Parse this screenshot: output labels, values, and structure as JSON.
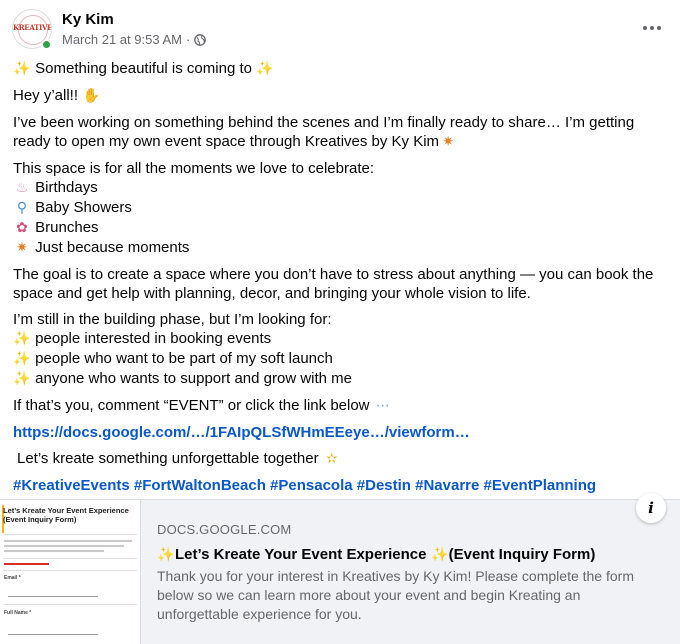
{
  "post": {
    "author": "Ky Kim",
    "avatar_logo_text": "KREATIVES",
    "timestamp": "March 21 at 9:53 AM",
    "privacy_separator": "·",
    "privacy_icon": "globe-icon",
    "more_icon": "more-options-icon",
    "online_status_color": "#31a24c"
  },
  "content": {
    "headline": "Something beautiful is coming to",
    "greeting": "Hey y’all!!",
    "intro_line1": "I’ve been working on something behind the scenes and I’m finally ready to share… I’m getting",
    "intro_line2": "ready to open my own event space through Kreatives by Ky Kim",
    "moments_heading": "This space is for all the moments we love to celebrate:",
    "moments": [
      {
        "icon": "birthday-cake-icon",
        "label": "Birthdays"
      },
      {
        "icon": "baby-bottle-icon",
        "label": "Baby Showers"
      },
      {
        "icon": "bouquet-icon",
        "label": "Brunches"
      },
      {
        "icon": "party-popper-icon",
        "label": "Just because moments"
      }
    ],
    "goal_line1": "The goal is to create a space where you don’t have to stress about anything — you can book the",
    "goal_line2": "space and get help with planning, decor, and bringing your whole vision to life.",
    "looking_heading": "I’m still in the building phase, but I’m looking for:",
    "looking_for": [
      "people interested in booking events",
      "people who want to be part of my soft launch",
      "anyone who wants to support and grow with me"
    ],
    "cta": "If that’s you, comment “EVENT” or click the link below",
    "link_text": "https://docs.google.com/…/1FAIpQLSfWHmEEeye…/viewform…",
    "closing": "Let’s kreate something unforgettable together",
    "hashtags": [
      "#KreativeEvents",
      "#FortWaltonBeach",
      "#Pensacola",
      "#Destin",
      "#Navarre",
      "#EventPlanning"
    ]
  },
  "link_card": {
    "domain": "DOCS.GOOGLE.COM",
    "title": "Let’s Kreate Your Event Experience",
    "title_suffix": "(Event Inquiry Form)",
    "description": "Thank you for your interest in Kreatives by Ky Kim! Please complete the form below so we can learn more about your event and begin Kreating an unforgettable experience for you.",
    "thumbnail_title": "Let’s Kreate Your Event Experience (Event Inquiry Form)",
    "thumbnail_field1": "Email *",
    "thumbnail_field2": "Full Name *",
    "info_label": "i"
  },
  "colors": {
    "link": "#0a58ca",
    "secondary_text": "#65676b",
    "card_background": "#f0f2f5"
  }
}
